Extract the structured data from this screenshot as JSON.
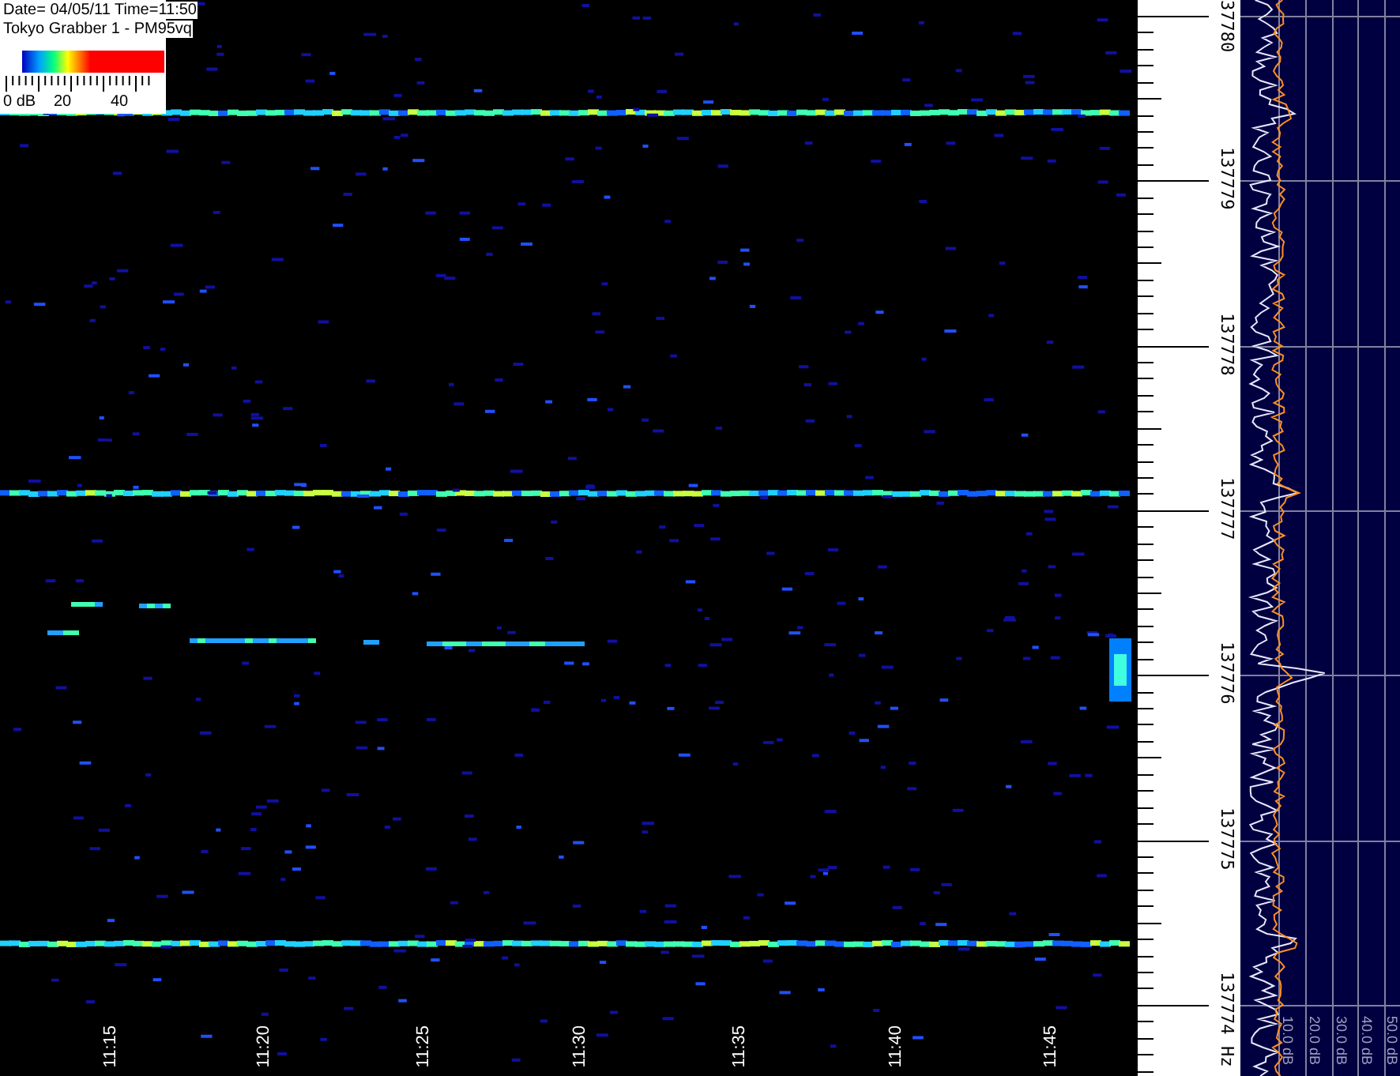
{
  "info": {
    "date_line": "Date= 04/05/11  Time=11:50",
    "station_line": "Tokyo Grabber 1 - PM95vq",
    "scale_labels": [
      "0 dB",
      "20",
      "40"
    ]
  },
  "frequency_axis": {
    "labels": [
      "37780",
      "137779",
      "137778",
      "137777",
      "137776",
      "137775",
      "137774"
    ],
    "unit": "Hz"
  },
  "time_axis": {
    "labels": [
      "11:15",
      "11:20",
      "11:25",
      "11:30",
      "11:35",
      "11:40",
      "11:45"
    ]
  },
  "spectrum": {
    "db_labels": [
      "10.0 dB",
      "20.0 dB",
      "30.0 dB",
      "40.0 dB",
      "50.0 dB"
    ]
  }
}
